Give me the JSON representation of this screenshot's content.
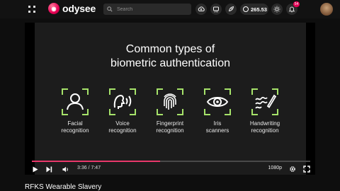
{
  "header": {
    "brand": "odysee",
    "search_placeholder": "Search",
    "wallet_balance": "265.53",
    "notification_count": "54",
    "icons": [
      "menu-icon",
      "search-icon",
      "upload-icon",
      "live-icon",
      "rocket-icon",
      "credits-icon",
      "sun-icon",
      "bell-icon"
    ]
  },
  "slide": {
    "title": "Common types of\nbiometric authentication",
    "accent_color": "#a6e36a",
    "methods": [
      {
        "label": "Facial\nrecognition",
        "icon": "face-icon"
      },
      {
        "label": "Voice\nrecognition",
        "icon": "voice-icon"
      },
      {
        "label": "Fingerprint\nrecognition",
        "icon": "fingerprint-icon"
      },
      {
        "label": "Iris\nscanners",
        "icon": "eye-icon"
      },
      {
        "label": "Handwriting\nrecognition",
        "icon": "handwriting-icon"
      }
    ]
  },
  "player": {
    "current_time": "3:36",
    "duration": "7:47",
    "time_display": "3:36  /  7:47",
    "progress": 0.46,
    "quality": "1080p",
    "progress_color": "#e8386a"
  },
  "video": {
    "title": "RFKS Wearable Slavery"
  }
}
